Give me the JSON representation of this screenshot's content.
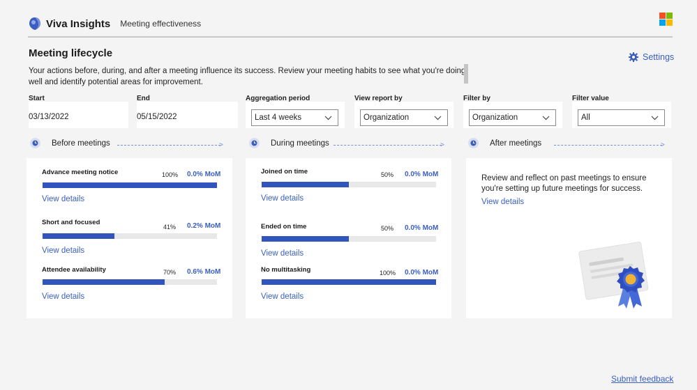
{
  "header": {
    "brand": "Viva Insights",
    "subtitle": "Meeting effectiveness",
    "brand_color": "#3a5fbf",
    "ms_colors": [
      "#f25022",
      "#7fba00",
      "#00a4ef",
      "#ffb900"
    ]
  },
  "page": {
    "title": "Meeting lifecycle",
    "settings_label": "Settings",
    "intro": "Your actions before, during, and after a meeting influence its success. Review your meeting habits to see what you're doing well and identify potential areas for improvement."
  },
  "filters": {
    "start": {
      "label": "Start",
      "value": "03/13/2022"
    },
    "end": {
      "label": "End",
      "value": "05/15/2022"
    },
    "aggregation": {
      "label": "Aggregation period",
      "value": "Last 4 weeks"
    },
    "view_report": {
      "label": "View report by",
      "value": "Organization"
    },
    "filter_by": {
      "label": "Filter by",
      "value": "Organization"
    },
    "filter_value": {
      "label": "Filter value",
      "value": "All"
    }
  },
  "phases": {
    "before": "Before meetings",
    "during": "During meetings",
    "after": "After meetings"
  },
  "before_metrics": [
    {
      "name": "Advance meeting notice",
      "pct": "100%",
      "fraction": 1.0,
      "mom": "0.0% MoM",
      "link": "View details"
    },
    {
      "name": "Short and focused",
      "pct": "41%",
      "fraction": 0.41,
      "mom": "0.2% MoM",
      "link": "View details"
    },
    {
      "name": "Attendee availability",
      "pct": "70%",
      "fraction": 0.7,
      "mom": "0.6% MoM",
      "link": "View details"
    }
  ],
  "during_metrics": [
    {
      "name": "Joined on time",
      "pct": "50%",
      "fraction": 0.5,
      "mom": "0.0% MoM",
      "link": "View details"
    },
    {
      "name": "Ended on time",
      "pct": "50%",
      "fraction": 0.5,
      "mom": "0.0% MoM",
      "link": "View details"
    },
    {
      "name": "No multitasking",
      "pct": "100%",
      "fraction": 1.0,
      "mom": "0.0% MoM",
      "link": "View details"
    }
  ],
  "after_card": {
    "text": "Review and reflect on past meetings to ensure you're setting up future meetings for success.",
    "link": "View details"
  },
  "footer": {
    "feedback": "Submit feedback"
  }
}
